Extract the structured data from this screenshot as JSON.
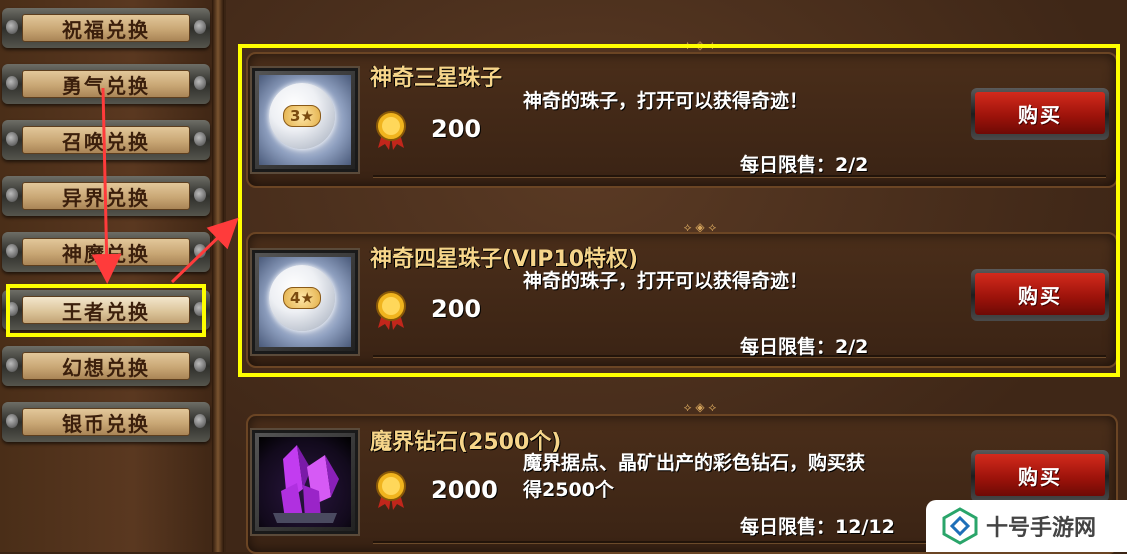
{
  "sidebar": {
    "tabs": [
      {
        "label": "祝福兑换"
      },
      {
        "label": "勇气兑换"
      },
      {
        "label": "召唤兑换"
      },
      {
        "label": "异界兑换"
      },
      {
        "label": "神魔兑换"
      },
      {
        "label": "王者兑换"
      },
      {
        "label": "幻想兑换"
      },
      {
        "label": "银币兑换"
      }
    ],
    "selected": "王者兑换"
  },
  "items": [
    {
      "title": "神奇三星珠子",
      "description": "神奇的珠子，打开可以获得奇迹！",
      "star_badge": "3★",
      "price": "200",
      "limit_label": "每日限售：",
      "limit_value": "2/2",
      "buy_label": "购买"
    },
    {
      "title": "神奇四星珠子(VIP10特权)",
      "description": "神奇的珠子，打开可以获得奇迹！",
      "star_badge": "4★",
      "price": "200",
      "limit_label": "每日限售：",
      "limit_value": "2/2",
      "buy_label": "购买"
    },
    {
      "title": "魔界钻石(2500个)",
      "description_line1": "魔界据点、晶矿出产的彩色钻石，购买获",
      "description_line2": "得2500个",
      "price": "2000",
      "limit_label": "每日限售：",
      "limit_value": "12/12",
      "buy_label": "购买"
    }
  ],
  "watermark": {
    "text": "十号手游网"
  },
  "colors": {
    "highlight": "#ffff00",
    "arrow": "#ff3b3b",
    "title_gold": "#f6d58a",
    "buy_red": "#c41e14"
  },
  "icons": [
    "gold-medal-icon",
    "star-orb-icon",
    "purple-crystal-icon",
    "watermark-logo-icon"
  ]
}
